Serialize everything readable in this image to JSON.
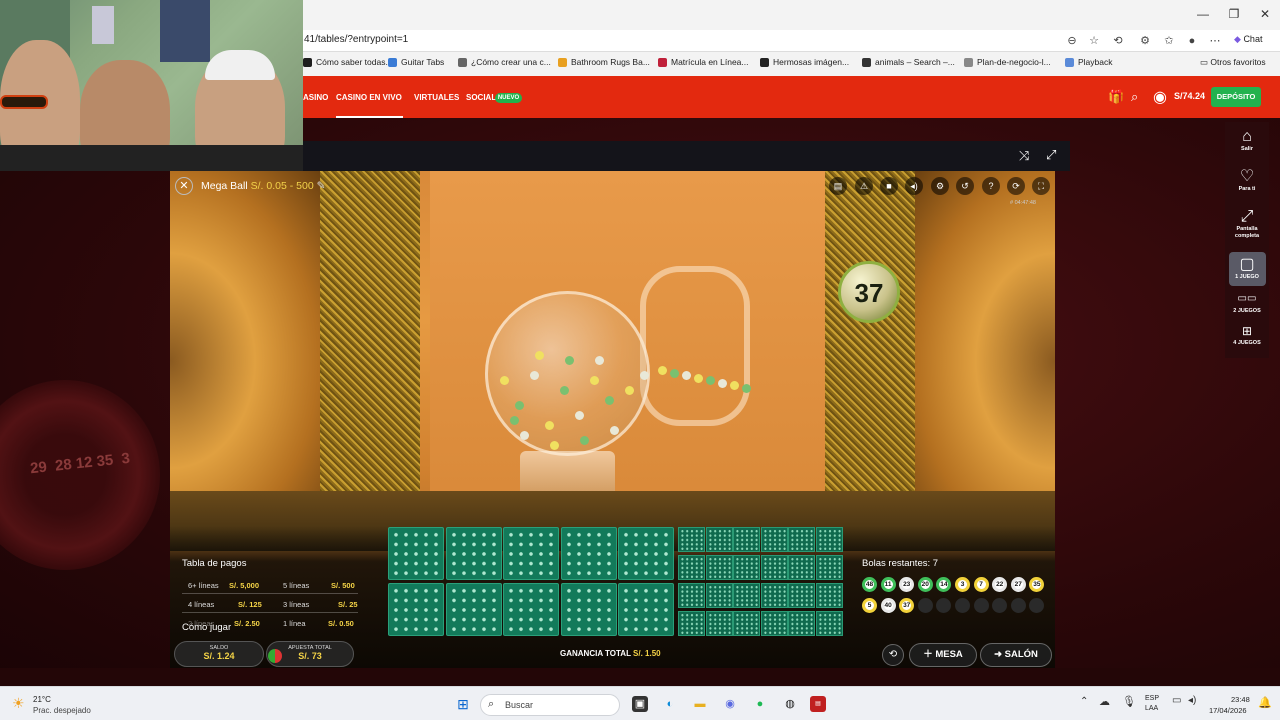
{
  "browser": {
    "url": "41/tables/?entrypoint=1",
    "bookmarks": [
      {
        "label": "Cómo saber todas...",
        "color": "#1e1e1e"
      },
      {
        "label": "Guitar Tabs",
        "color": "#3a7bd5"
      },
      {
        "label": "¿Cómo crear una c...",
        "color": "#666666"
      },
      {
        "label": "Bathroom Rugs Ba...",
        "color": "#e8a020"
      },
      {
        "label": "Matrícula en Línea...",
        "color": "#c0203a"
      },
      {
        "label": "Hermosas imágen...",
        "color": "#222222"
      },
      {
        "label": "animals – Search –...",
        "color": "#333333"
      },
      {
        "label": "Plan-de-negocio-l...",
        "color": "#888888"
      },
      {
        "label": "Playback",
        "color": "#5a8ad8"
      }
    ],
    "other_favorites": "Otros favoritos",
    "chat_label": "Chat"
  },
  "site_nav": {
    "items": [
      "ASINO",
      "CASINO EN VIVO",
      "VIRTUALES",
      "SOCIAL"
    ],
    "badge_new": "NUEVO",
    "balance": "S/74.24",
    "deposit": "DEPÓSITO",
    "accent": "#e3290f"
  },
  "right_sidebar": {
    "items": [
      {
        "label": "Salir",
        "icon": "home-icon"
      },
      {
        "label": "Para ti",
        "icon": "heart-icon"
      },
      {
        "label": "Pantalla completa",
        "icon": "fullscreen-icon"
      },
      {
        "label": "1 JUEGO",
        "icon": "single-game-icon"
      },
      {
        "label": "2 JUEGOS",
        "icon": "two-games-icon"
      },
      {
        "label": "4 JUEGOS",
        "icon": "four-games-icon"
      }
    ]
  },
  "game": {
    "name": "Mega Ball",
    "range": "S/. 0.05 - 500",
    "time_code": "# 04:47:48",
    "drawn_ball": "37",
    "paytable_title": "Tabla de pagos",
    "paytable": [
      {
        "lines": "6+ líneas",
        "payout": "S/. 5,000"
      },
      {
        "lines": "5 líneas",
        "payout": "S/. 500"
      },
      {
        "lines": "4 líneas",
        "payout": "S/. 125"
      },
      {
        "lines": "3 líneas",
        "payout": "S/. 25"
      },
      {
        "lines": "2 líneas",
        "payout": "S/. 2.50"
      },
      {
        "lines": "1 línea",
        "payout": "S/. 0.50"
      }
    ],
    "how_to_play": "Cómo jugar",
    "saldo_label": "SALDO",
    "saldo_value": "S/. 1.24",
    "apuesta_label": "APUESTA TOTAL",
    "apuesta_value": "S/. 73",
    "ganancia_label": "GANANCIA TOTAL",
    "ganancia_value": "S/. 1.50",
    "remaining_title": "Bolas restantes: 7",
    "called_balls": [
      {
        "n": "48",
        "color": "#3fbf5a"
      },
      {
        "n": "11",
        "color": "#3fbf5a"
      },
      {
        "n": "23",
        "color": "#e8e8e8"
      },
      {
        "n": "20",
        "color": "#3fbf5a"
      },
      {
        "n": "14",
        "color": "#3fbf5a"
      },
      {
        "n": "3",
        "color": "#f2d23a"
      },
      {
        "n": "7",
        "color": "#f2d23a"
      },
      {
        "n": "22",
        "color": "#e8e8e8"
      },
      {
        "n": "27",
        "color": "#e8e8e8"
      },
      {
        "n": "35",
        "color": "#f2d23a"
      },
      {
        "n": "5",
        "color": "#f2d23a"
      },
      {
        "n": "40",
        "color": "#e8e8e8"
      },
      {
        "n": "37",
        "color": "#f2d23a"
      }
    ],
    "mesa_label": "MESA",
    "salon_label": "SALÓN"
  },
  "taskbar": {
    "temperature": "21°C",
    "weather": "Prac. despejado",
    "search_placeholder": "Buscar",
    "lang_top": "ESP",
    "lang_bottom": "LAA",
    "time": "23:48",
    "date": "17/04/2026"
  }
}
